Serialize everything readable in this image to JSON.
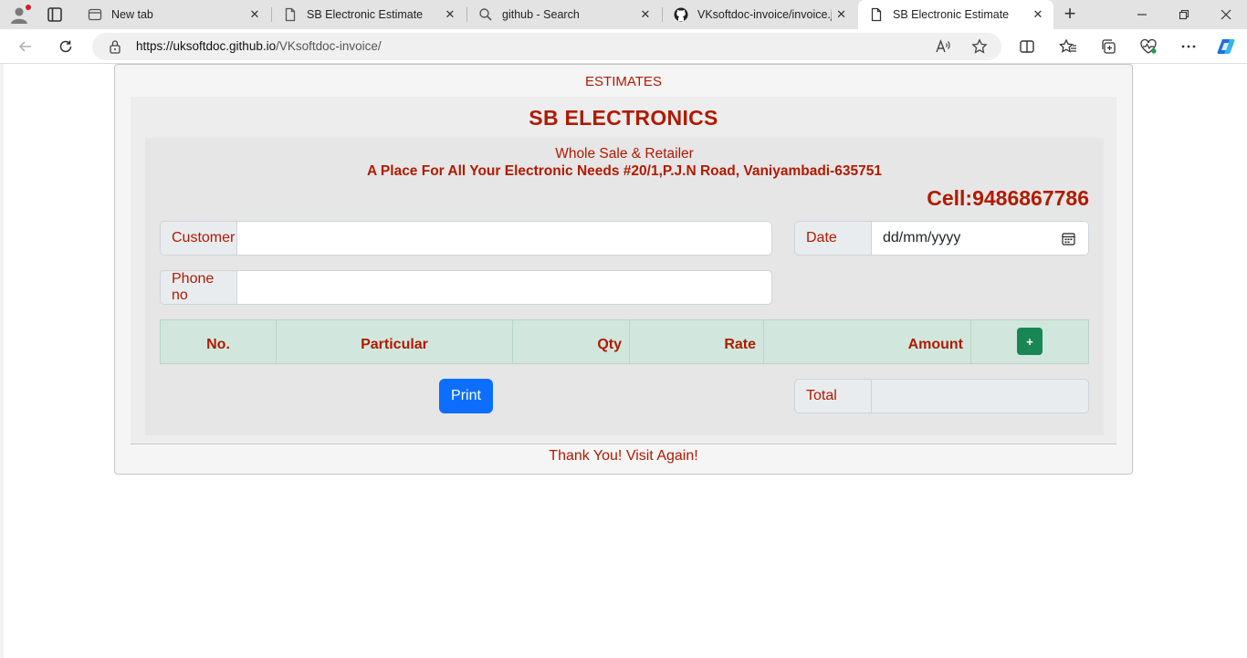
{
  "browser": {
    "tabs": [
      {
        "label": "New tab",
        "icon": "page-icon"
      },
      {
        "label": "SB Electronic Estimate",
        "icon": "document-icon"
      },
      {
        "label": "github - Search",
        "icon": "search-icon"
      },
      {
        "label": "VKsoftdoc-invoice/invoice.js",
        "icon": "github-icon"
      },
      {
        "label": "SB Electronic Estimate",
        "icon": "document-icon",
        "active": true
      }
    ],
    "url_host": "https://uksoftdoc.github.io",
    "url_path": "/VKsoftdoc-invoice/"
  },
  "page": {
    "header": "ESTIMATES",
    "shop_name": "SB ELECTRONICS",
    "tagline": "Whole Sale & Retailer",
    "address": "A Place For All Your Electronic Needs #20/1,P.J.N Road, Vaniyambadi-635751",
    "cell": "Cell:9486867786",
    "customer_label": "Customer",
    "customer_value": "",
    "date_label": "Date",
    "date_placeholder": "dd/mm/yyyy",
    "phone_label": "Phone no",
    "phone_value": "",
    "table_headers": [
      "No.",
      "Particular",
      "Qty",
      "Rate",
      "Amount"
    ],
    "add_button": "+",
    "print_button": "Print",
    "total_label": "Total",
    "total_value": "",
    "footer": "Thank You! Visit Again!"
  },
  "colors": {
    "accent_text": "#b01a00",
    "add_button": "#198754",
    "print_button": "#0d6efd",
    "table_header_bg": "#d1e7dd"
  }
}
